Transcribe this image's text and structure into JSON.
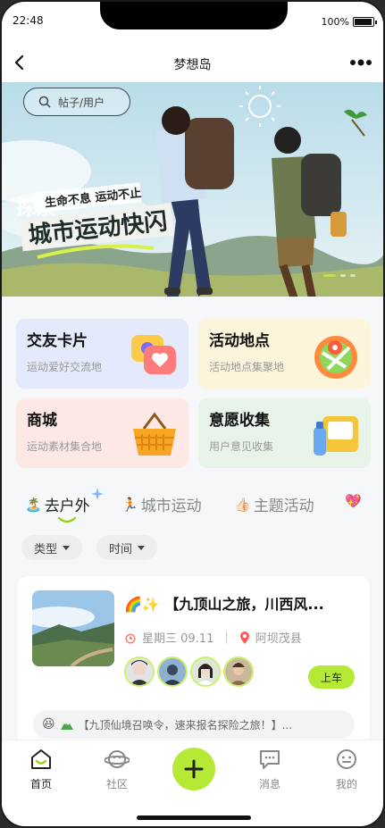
{
  "status": {
    "time": "22:48",
    "battery": "100%"
  },
  "navbar": {
    "title": "梦想岛"
  },
  "search": {
    "placeholder": "帖子/用户"
  },
  "banner": {
    "kicker": "探索",
    "line1": "生命不息 运动不止",
    "line2": "城市运动快闪"
  },
  "quick_cards": [
    {
      "title": "交友卡片",
      "subtitle": "运动爱好交流地",
      "bg": "#e4e9fb"
    },
    {
      "title": "活动地点",
      "subtitle": "活动地点集聚地",
      "bg": "#fdf4dc"
    },
    {
      "title": "商城",
      "subtitle": "运动素材集合地",
      "bg": "#fde8e6"
    },
    {
      "title": "意愿收集",
      "subtitle": "用户意见收集",
      "bg": "#e8f3ea"
    }
  ],
  "tabs": [
    {
      "emoji": "🏝️",
      "label": "去户外"
    },
    {
      "emoji": "🏃",
      "label": "城市运动"
    },
    {
      "emoji": "👍🏻",
      "label": "主题活动"
    },
    {
      "emoji": "💖",
      "label": ""
    }
  ],
  "filters": [
    {
      "label": "类型"
    },
    {
      "label": "时间"
    }
  ],
  "post": {
    "emoji": "🌈✨",
    "title": "【九顶山之旅，川西风...",
    "date": "星期三 09.11",
    "location": "阿坝茂县",
    "join_label": "上车",
    "notice": "【九顶仙境召唤令，速来报名探险之旅！】..."
  },
  "tabbar": [
    {
      "label": "首页"
    },
    {
      "label": "社区"
    },
    {
      "label": "消息"
    },
    {
      "label": "我的"
    }
  ],
  "colors": {
    "accent": "#b5e936"
  }
}
